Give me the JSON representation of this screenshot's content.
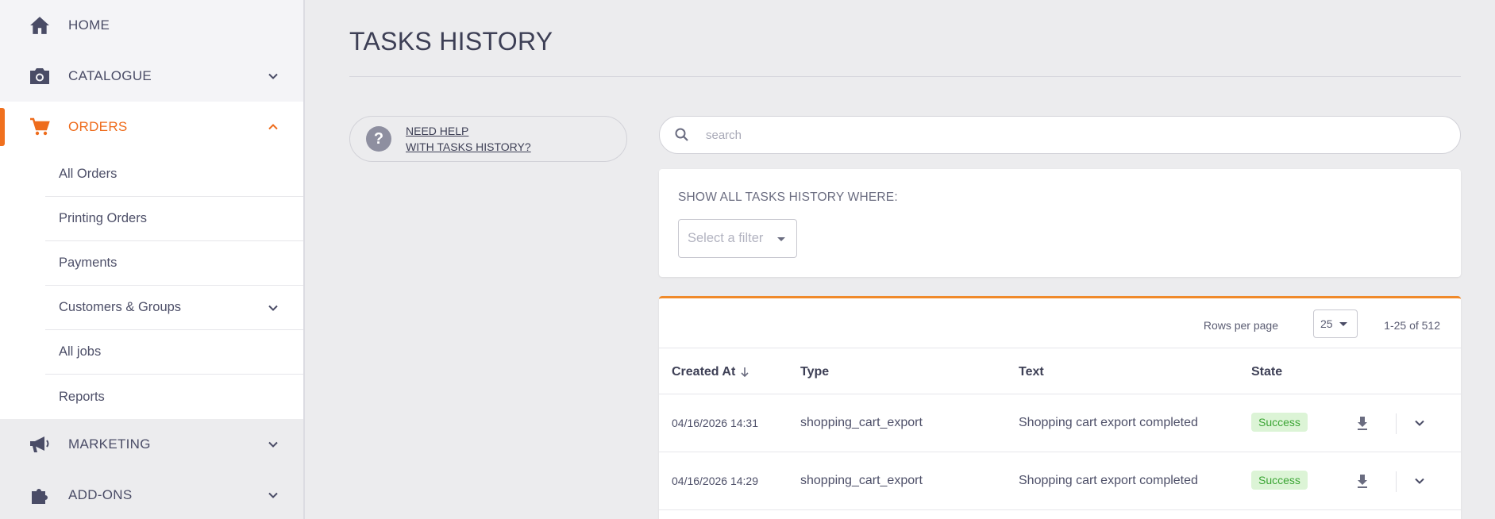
{
  "sidebar": {
    "items": [
      {
        "label": "HOME",
        "icon": "home-icon"
      },
      {
        "label": "CATALOGUE",
        "icon": "camera-icon"
      },
      {
        "label": "ORDERS",
        "icon": "cart-icon"
      },
      {
        "label": "MARKETING",
        "icon": "megaphone-icon"
      },
      {
        "label": "ADD-ONS",
        "icon": "puzzle-icon"
      }
    ],
    "orders_sub": [
      {
        "label": "All Orders"
      },
      {
        "label": "Printing Orders"
      },
      {
        "label": "Payments"
      },
      {
        "label": "Customers & Groups"
      },
      {
        "label": "All jobs"
      },
      {
        "label": "Reports"
      }
    ]
  },
  "main": {
    "title": "TASKS HISTORY",
    "help": {
      "line1": "NEED HELP",
      "line2": "WITH TASKS HISTORY?"
    },
    "search": {
      "placeholder": "search"
    },
    "filter": {
      "heading": "SHOW ALL TASKS HISTORY WHERE:",
      "placeholder": "Select a filter"
    },
    "pager": {
      "rows_label": "Rows per page",
      "rows_value": "25",
      "range": "1-25 of 512"
    },
    "columns": {
      "created_at": "Created At",
      "type": "Type",
      "text": "Text",
      "state": "State"
    },
    "rows": [
      {
        "created_at": "04/16/2026 14:31",
        "type": "shopping_cart_export",
        "text": "Shopping cart export completed",
        "state": "Success"
      },
      {
        "created_at": "04/16/2026 14:29",
        "type": "shopping_cart_export",
        "text": "Shopping cart export completed",
        "state": "Success"
      }
    ]
  },
  "colors": {
    "accent": "#ee6c1c",
    "success_bg": "#dcf4d6",
    "success_text": "#3ba534"
  }
}
